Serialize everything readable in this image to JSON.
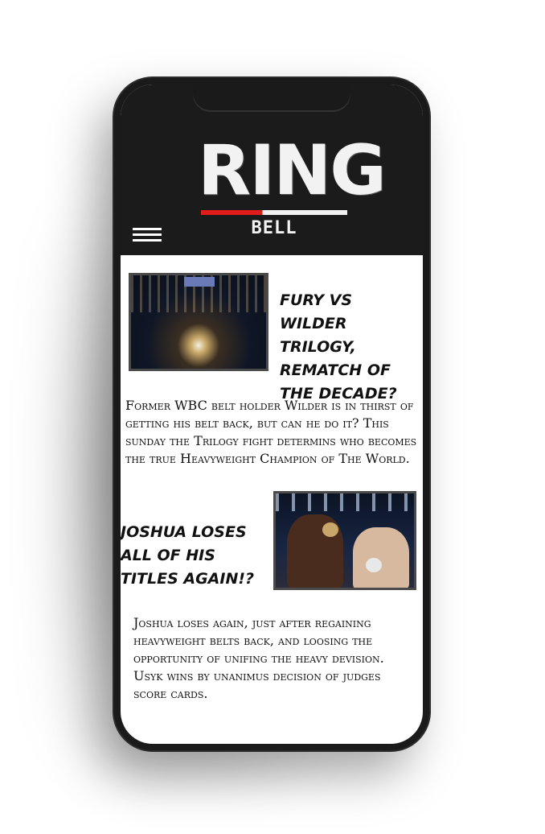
{
  "header": {
    "logo_main": "RING",
    "logo_sub": "BELL",
    "menu_icon": "hamburger-menu-icon"
  },
  "articles": [
    {
      "headline": "FURY VS WILDER TRILOGY, REMATCH OF THE DECADE?",
      "body": "Former WBC belt holder Wilder is in thirst of getting his belt back, but can he do it? This sunday the Trilogy fight determins who becomes the true Heavyweight Champion of The World."
    },
    {
      "headline": "JOSHUA LOSES ALL OF HIS TITLES AGAIN!?",
      "body": "Joshua loses again, just after regaining heavyweight belts back, and loosing the opportunity of unifing the heavy devision. Usyk wins by unanimus decision of judges score cards."
    }
  ],
  "colors": {
    "header_bg": "#1b1b1b",
    "accent_red": "#e21b1b",
    "logo_white": "#f2f2f2"
  }
}
